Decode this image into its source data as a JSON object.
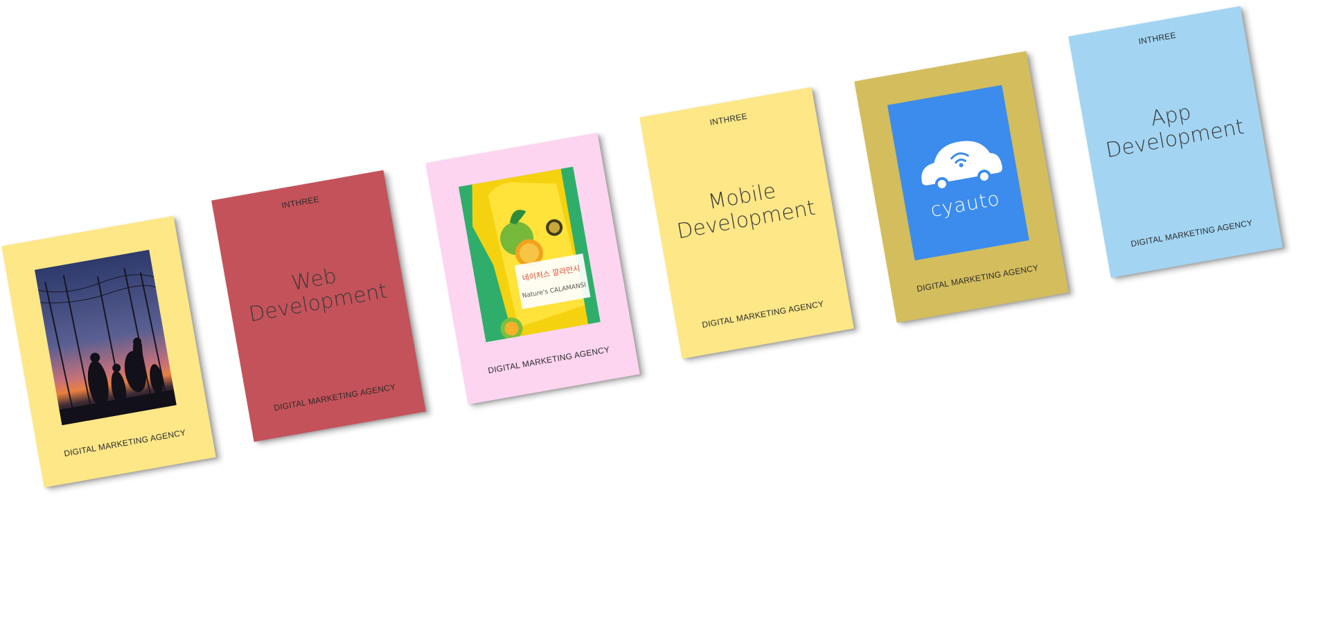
{
  "colors": {
    "card_yellow": "#fde787",
    "card_red": "#c4525a",
    "card_pink": "#fdd5f0",
    "card_gold": "#d4bd5d",
    "card_blue": "#a3d5f3",
    "cyauto_blue": "#3b8ced"
  },
  "cards": [
    {
      "kind": "image",
      "image_name": "sunset-silhouette-image",
      "agency": "DIGITAL MARKETING AGENCY"
    },
    {
      "kind": "text",
      "brand": "INTHREE",
      "title": "Web\nDevelopment",
      "agency": "DIGITAL MARKETING AGENCY"
    },
    {
      "kind": "image",
      "image_name": "calamansi-product-image",
      "product_korean": "네이처스 깔라만시",
      "product_english": "Nature's CALAMANSI",
      "agency": "DIGITAL MARKETING AGENCY"
    },
    {
      "kind": "text",
      "brand": "INTHREE",
      "title": "Mobile\nDevelopment",
      "agency": "DIGITAL MARKETING AGENCY"
    },
    {
      "kind": "image",
      "image_name": "cyauto-logo-image",
      "logo_text": "cyauto",
      "agency": "DIGITAL MARKETING AGENCY"
    },
    {
      "kind": "text",
      "brand": "INTHREE",
      "title": "App\nDevelopment",
      "agency": "DIGITAL MARKETING AGENCY"
    }
  ]
}
